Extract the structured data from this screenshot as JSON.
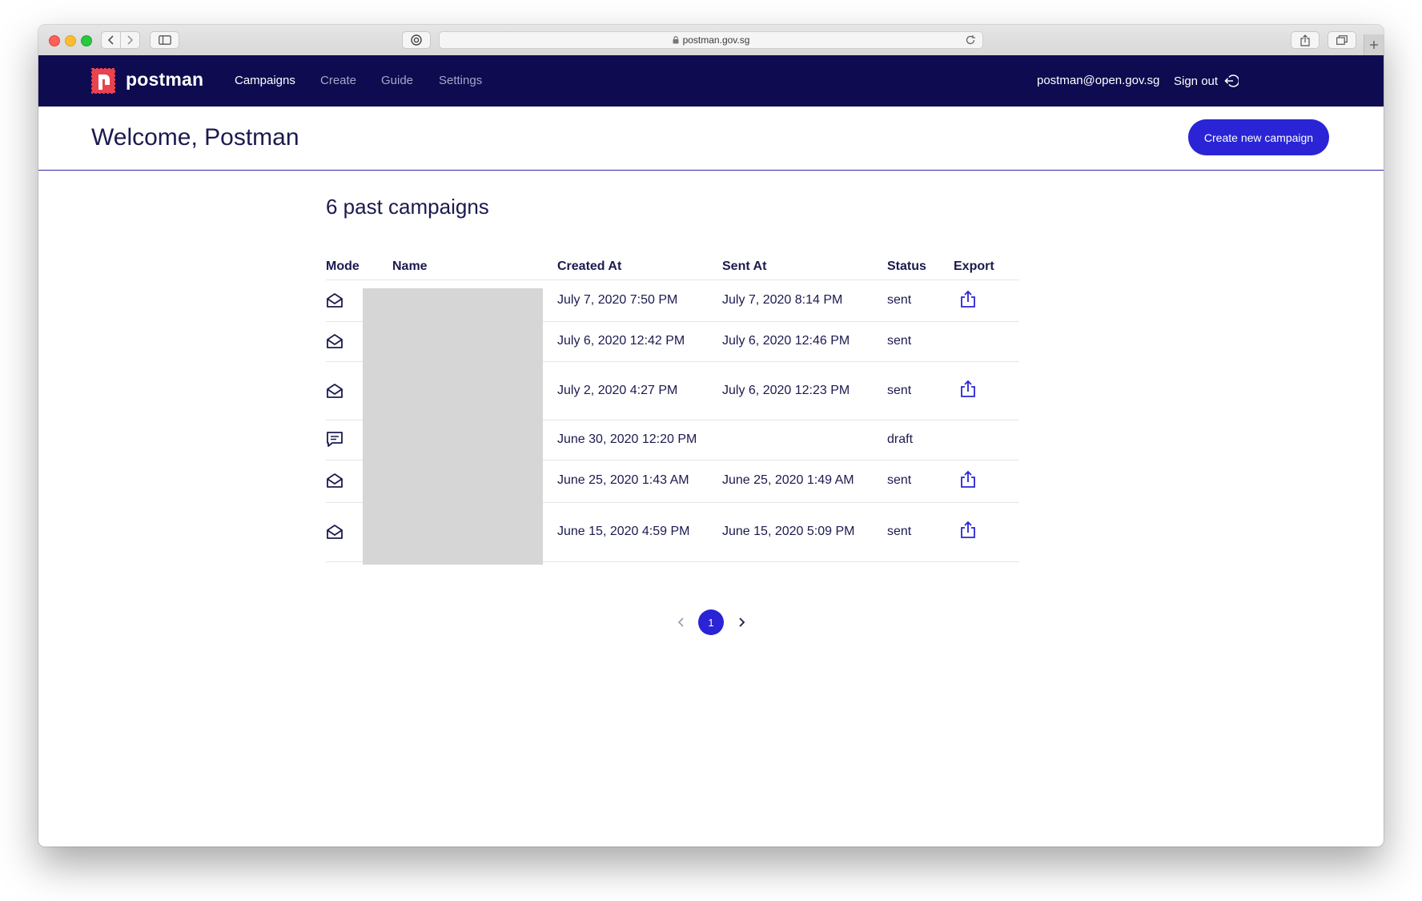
{
  "browser": {
    "url": "postman.gov.sg"
  },
  "navbar": {
    "brand": "postman",
    "links": [
      {
        "label": "Campaigns",
        "active": true
      },
      {
        "label": "Create",
        "active": false
      },
      {
        "label": "Guide",
        "active": false
      },
      {
        "label": "Settings",
        "active": false
      }
    ],
    "user_email": "postman@open.gov.sg",
    "signout_label": "Sign out"
  },
  "header": {
    "welcome": "Welcome, Postman",
    "create_button": "Create new campaign"
  },
  "main": {
    "count_title": "6 past campaigns",
    "columns": [
      "Mode",
      "Name",
      "Created At",
      "Sent At",
      "Status",
      "Export"
    ],
    "rows": [
      {
        "mode": "email",
        "name": "",
        "created_at": "July 7, 2020 7:50 PM",
        "sent_at": "July 7, 2020 8:14 PM",
        "status": "sent",
        "export": true
      },
      {
        "mode": "email",
        "name": "",
        "created_at": "July 6, 2020 12:42 PM",
        "sent_at": "July 6, 2020 12:46 PM",
        "status": "sent",
        "export": false
      },
      {
        "mode": "email",
        "name": "",
        "created_at": "July 2, 2020 4:27 PM",
        "sent_at": "July 6, 2020 12:23 PM",
        "status": "sent",
        "export": true
      },
      {
        "mode": "sms",
        "name": "",
        "created_at": "June 30, 2020 12:20 PM",
        "sent_at": "",
        "status": "draft",
        "export": false
      },
      {
        "mode": "email",
        "name": "",
        "created_at": "June 25, 2020 1:43 AM",
        "sent_at": "June 25, 2020 1:49 AM",
        "status": "sent",
        "export": true
      },
      {
        "mode": "email",
        "name": "",
        "created_at": "June 15, 2020 4:59 PM",
        "sent_at": "June 15, 2020 5:09 PM",
        "status": "sent",
        "export": true
      }
    ]
  },
  "pagination": {
    "current_page": "1",
    "prev_icon": "chevron-left-icon",
    "next_icon": "chevron-right-icon"
  },
  "colors": {
    "navbar": "#0e0b50",
    "accent": "#2a24d6",
    "text": "#1b1a4f"
  }
}
